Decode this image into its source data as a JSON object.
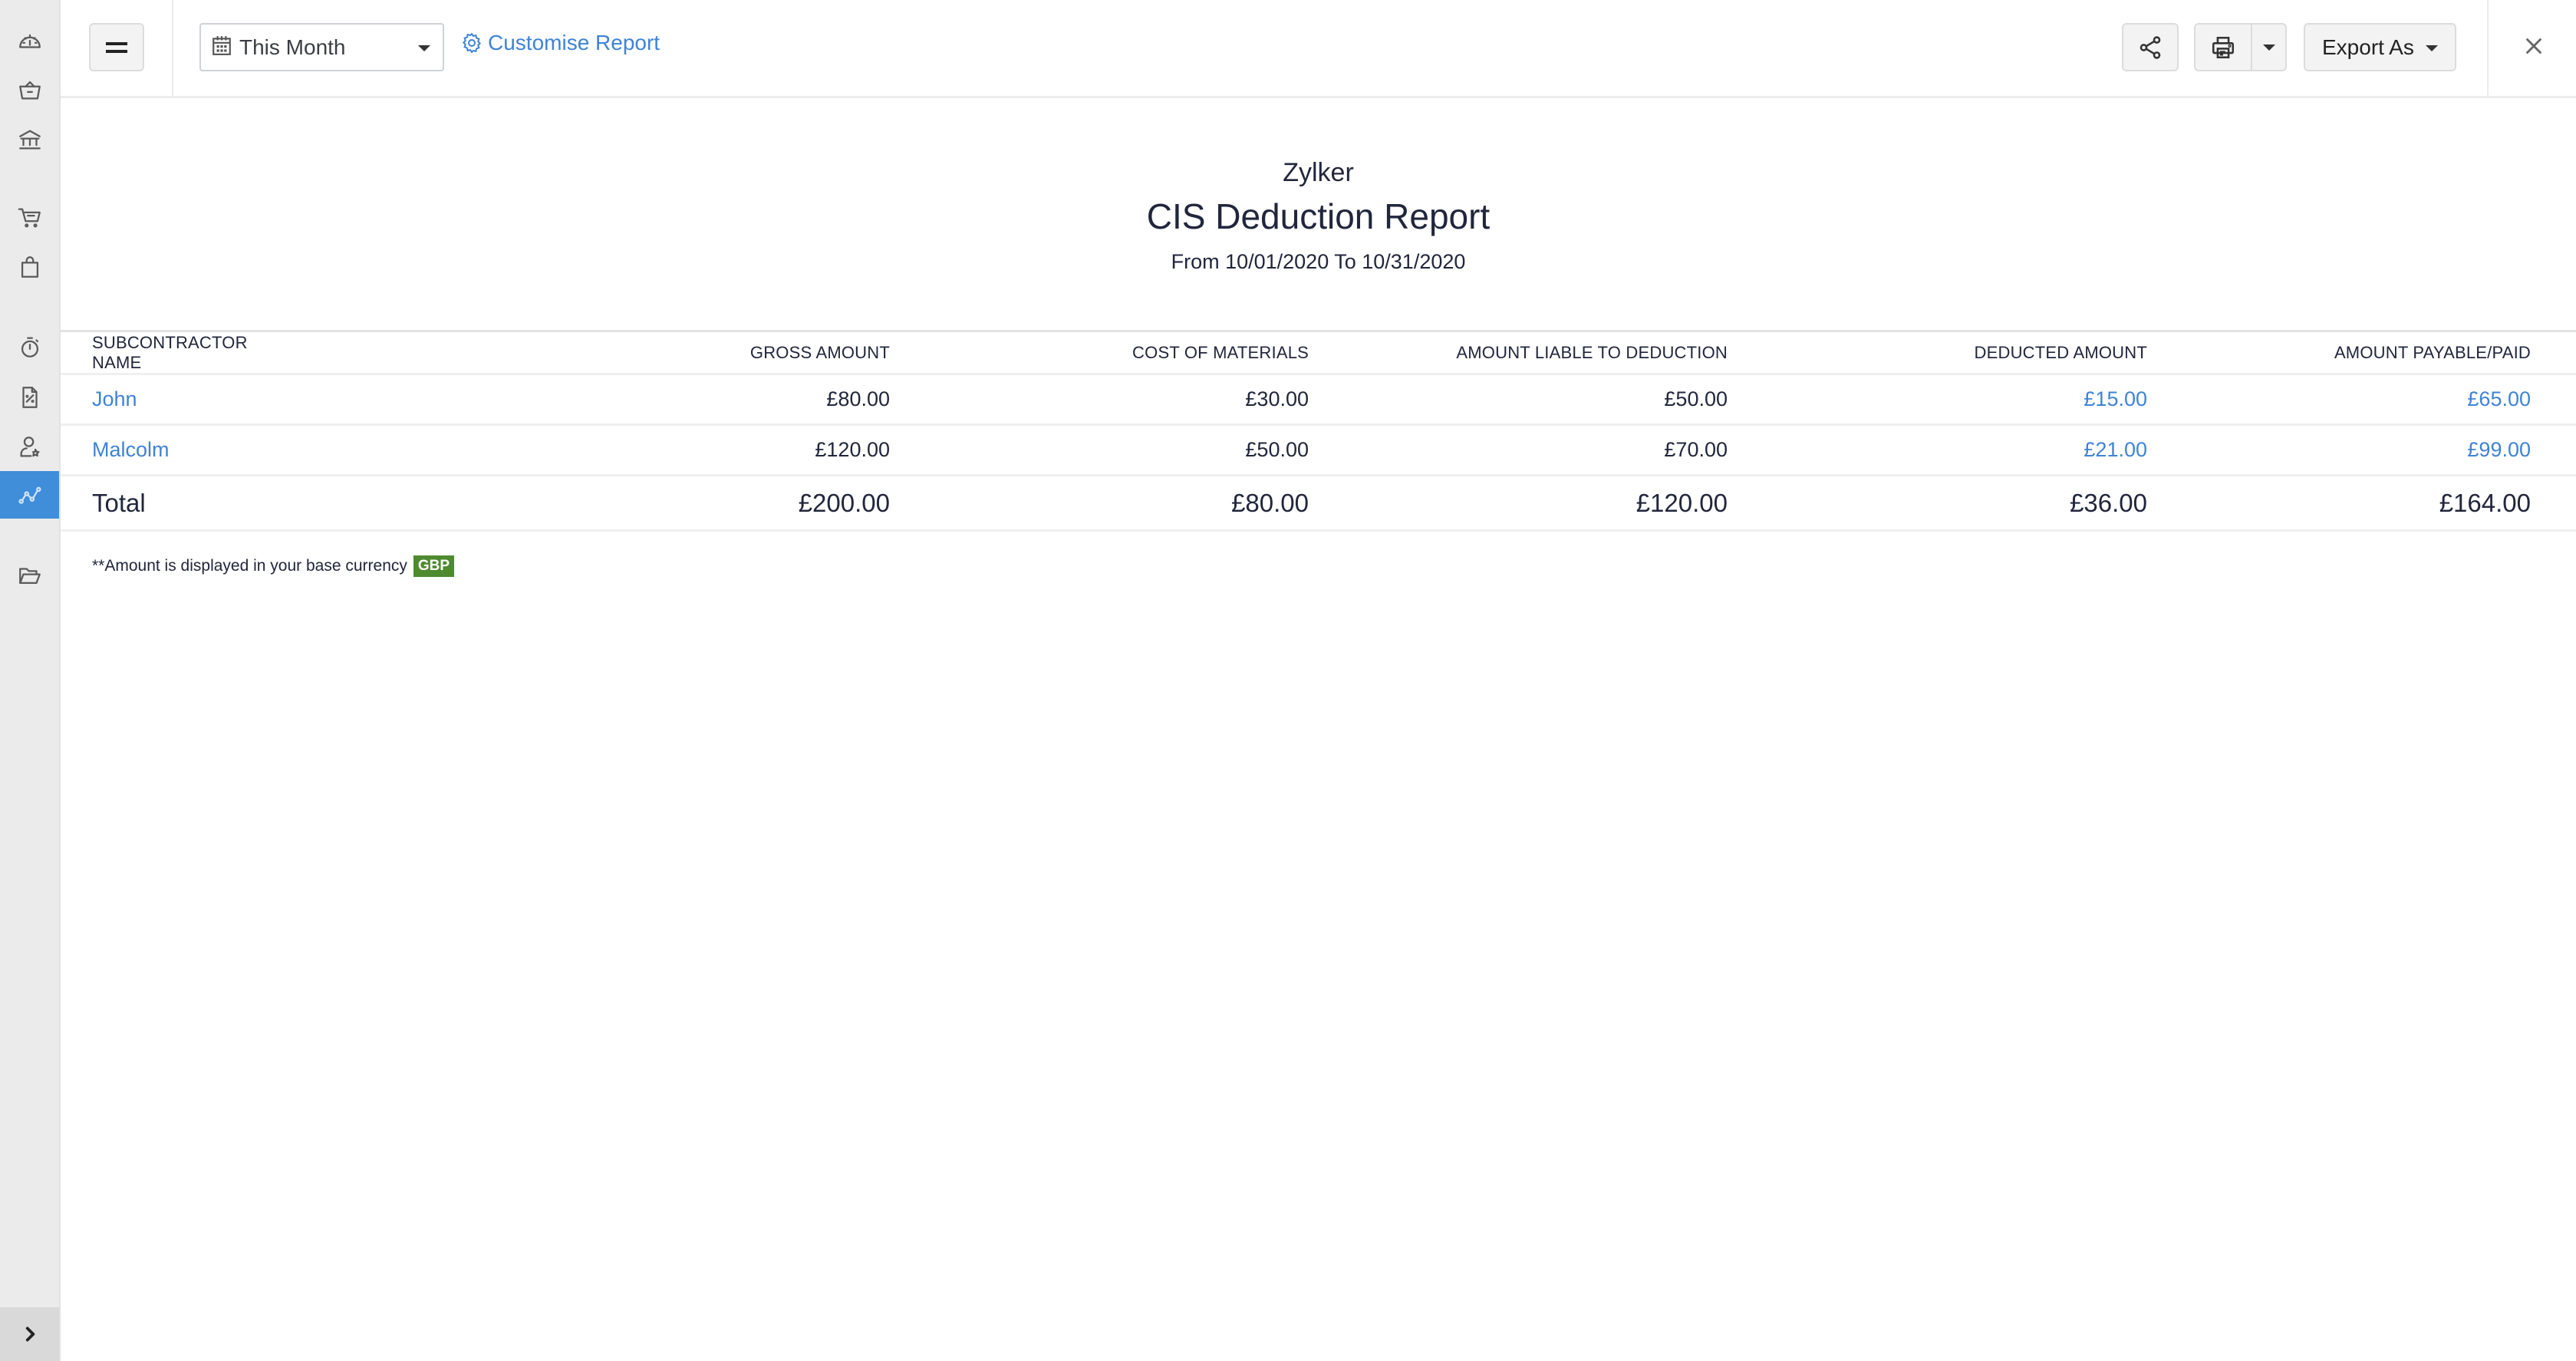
{
  "sidebar": {
    "items": [
      {
        "icon": "dashboard-icon",
        "label": "Dashboard"
      },
      {
        "icon": "sales-basket-icon",
        "label": "Sales"
      },
      {
        "icon": "bank-icon",
        "label": "Banking"
      },
      {
        "icon": "cart-icon",
        "label": "Purchases"
      },
      {
        "icon": "bag-icon",
        "label": "Items"
      },
      {
        "icon": "timer-icon",
        "label": "Time Tracking"
      },
      {
        "icon": "tax-document-icon",
        "label": "Taxes"
      },
      {
        "icon": "user-star-icon",
        "label": "Accountant"
      },
      {
        "icon": "reports-chart-icon",
        "label": "Reports",
        "active": true
      },
      {
        "icon": "folder-icon",
        "label": "Documents"
      }
    ],
    "expand_icon": "chevron-right-icon"
  },
  "toolbar": {
    "menu_icon": "hamburger-icon",
    "date_range": "This Month",
    "customise_label": "Customise Report",
    "share_icon": "share-icon",
    "print_icon": "printer-icon",
    "export_label": "Export As",
    "close_icon": "close-icon"
  },
  "report": {
    "organization": "Zylker",
    "title": "CIS Deduction Report",
    "date_range": "From 10/01/2020 To 10/31/2020",
    "columns": [
      "SUBCONTRACTOR NAME",
      "GROSS AMOUNT",
      "COST OF MATERIALS",
      "AMOUNT LIABLE TO DEDUCTION",
      "DEDUCTED AMOUNT",
      "AMOUNT PAYABLE/PAID"
    ],
    "rows": [
      {
        "name": "John",
        "gross": "£80.00",
        "materials": "£30.00",
        "liable": "£50.00",
        "deducted": "£15.00",
        "payable": "£65.00"
      },
      {
        "name": "Malcolm",
        "gross": "£120.00",
        "materials": "£50.00",
        "liable": "£70.00",
        "deducted": "£21.00",
        "payable": "£99.00"
      }
    ],
    "total": {
      "label": "Total",
      "gross": "£200.00",
      "materials": "£80.00",
      "liable": "£120.00",
      "deducted": "£36.00",
      "payable": "£164.00"
    },
    "footnote": "**Amount is displayed in your base currency",
    "currency_badge": "GBP"
  },
  "colors": {
    "accent": "#408dd9",
    "link": "#3f83d6",
    "badge": "#4e8a2e",
    "sidebar_bg": "#ebebeb"
  }
}
